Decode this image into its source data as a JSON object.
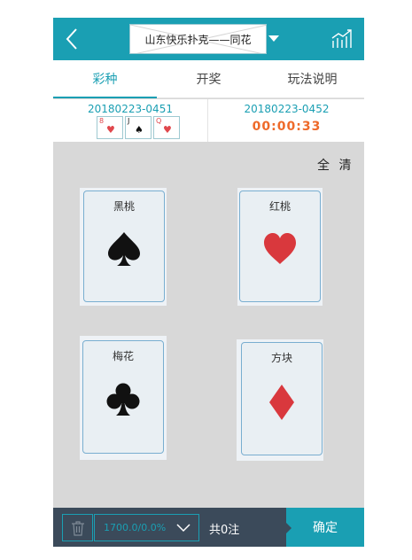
{
  "header": {
    "title": "山东快乐扑克——同花",
    "back_icon": "chevron-left-icon",
    "dropdown_icon": "caret-down-icon",
    "trend_icon": "trend-chart-icon",
    "color": "#1a9fb3"
  },
  "tabs": [
    {
      "label": "彩种",
      "active": true
    },
    {
      "label": "开奖",
      "active": false
    },
    {
      "label": "玩法说明",
      "active": false
    }
  ],
  "last_draw": {
    "period": "20180223-0451",
    "cards": [
      {
        "rank": "8",
        "suit": "heart",
        "symbol": "♥",
        "color": "#e0474c"
      },
      {
        "rank": "J",
        "suit": "spade",
        "symbol": "♠",
        "color": "#111111"
      },
      {
        "rank": "Q",
        "suit": "heart",
        "symbol": "♥",
        "color": "#e0474c"
      }
    ]
  },
  "next_draw": {
    "period": "20180223-0452",
    "countdown": "00:00:33",
    "countdown_color": "#ee6a2a"
  },
  "clear_label": "全 清",
  "suits": [
    {
      "label": "黑桃",
      "symbol": "♠",
      "color": "#111111",
      "name": "spade"
    },
    {
      "label": "红桃",
      "symbol": "♥",
      "color": "#d9383d",
      "name": "heart"
    },
    {
      "label": "梅花",
      "symbol": "♣",
      "color": "#111111",
      "name": "club"
    },
    {
      "label": "方块",
      "symbol": "♦",
      "color": "#d9383d",
      "name": "diamond"
    }
  ],
  "bottom_bar": {
    "trash_icon": "trash-icon",
    "odds_value": "1700.0/0.0%",
    "odds_caret_icon": "chevron-down-icon",
    "count_text": "共0注",
    "confirm_label": "确定"
  }
}
